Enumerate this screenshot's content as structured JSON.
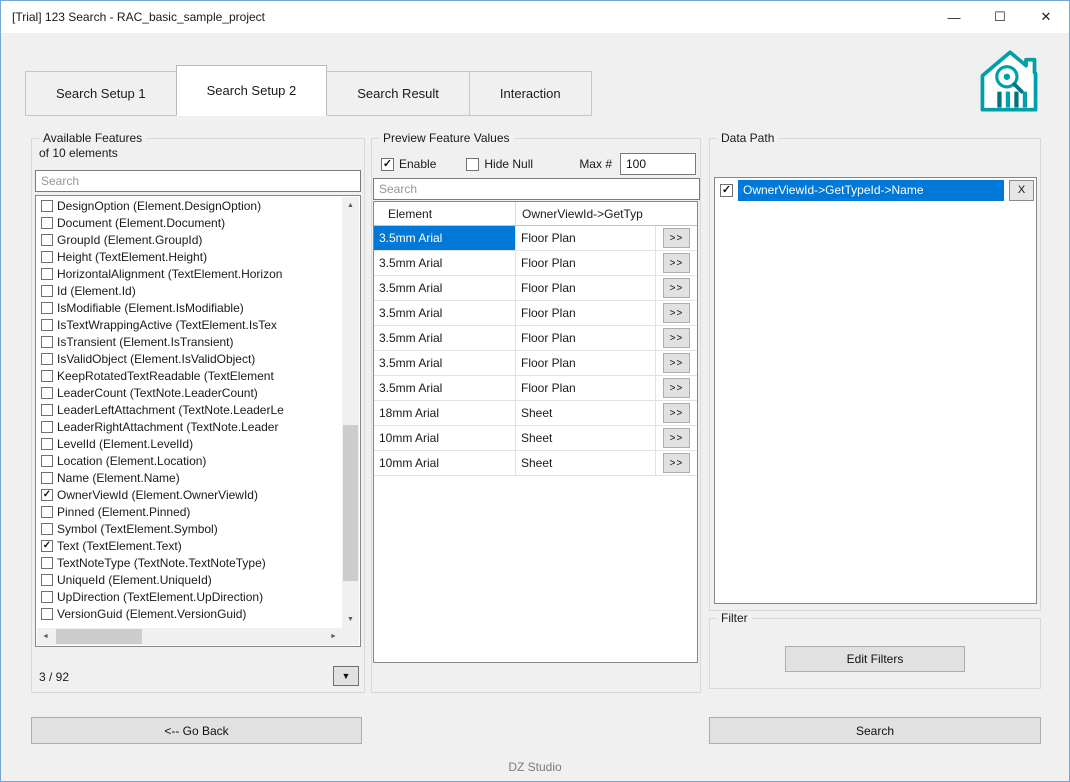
{
  "window": {
    "title": "[Trial] 123 Search - RAC_basic_sample_project",
    "controls": {
      "minimize": "—",
      "maximize": "☐",
      "close": "✕"
    },
    "footer": "DZ Studio"
  },
  "tabs": [
    {
      "label": "Search Setup 1",
      "active": false
    },
    {
      "label": "Search Setup 2",
      "active": true
    },
    {
      "label": "Search Result",
      "active": false
    },
    {
      "label": "Interaction",
      "active": false
    }
  ],
  "icons": {
    "scroll_up": "▲",
    "scroll_down": "▼",
    "scroll_left": "◄",
    "scroll_right": "►",
    "dropdown": "▼"
  },
  "features_panel": {
    "title": "Available Features",
    "subtitle": "of 10 elements",
    "search_placeholder": "Search",
    "status": "3 / 92",
    "items": [
      {
        "label": "DesignOption (Element.DesignOption)",
        "checked": false
      },
      {
        "label": "Document (Element.Document)",
        "checked": false
      },
      {
        "label": "GroupId (Element.GroupId)",
        "checked": false
      },
      {
        "label": "Height (TextElement.Height)",
        "checked": false
      },
      {
        "label": "HorizontalAlignment (TextElement.Horizon",
        "checked": false
      },
      {
        "label": "Id (Element.Id)",
        "checked": false
      },
      {
        "label": "IsModifiable (Element.IsModifiable)",
        "checked": false
      },
      {
        "label": "IsTextWrappingActive (TextElement.IsTex",
        "checked": false
      },
      {
        "label": "IsTransient (Element.IsTransient)",
        "checked": false
      },
      {
        "label": "IsValidObject (Element.IsValidObject)",
        "checked": false
      },
      {
        "label": "KeepRotatedTextReadable (TextElement",
        "checked": false
      },
      {
        "label": "LeaderCount (TextNote.LeaderCount)",
        "checked": false
      },
      {
        "label": "LeaderLeftAttachment (TextNote.LeaderLe",
        "checked": false
      },
      {
        "label": "LeaderRightAttachment (TextNote.Leader",
        "checked": false
      },
      {
        "label": "LevelId (Element.LevelId)",
        "checked": false
      },
      {
        "label": "Location (Element.Location)",
        "checked": false
      },
      {
        "label": "Name (Element.Name)",
        "checked": false
      },
      {
        "label": "OwnerViewId (Element.OwnerViewId)",
        "checked": true
      },
      {
        "label": "Pinned (Element.Pinned)",
        "checked": false
      },
      {
        "label": "Symbol (TextElement.Symbol)",
        "checked": false
      },
      {
        "label": "Text (TextElement.Text)",
        "checked": true
      },
      {
        "label": "TextNoteType (TextNote.TextNoteType)",
        "checked": false
      },
      {
        "label": "UniqueId (Element.UniqueId)",
        "checked": false
      },
      {
        "label": "UpDirection (TextElement.UpDirection)",
        "checked": false
      },
      {
        "label": "VersionGuid (Element.VersionGuid)",
        "checked": false
      }
    ]
  },
  "preview_panel": {
    "title": "Preview Feature Values",
    "enable": {
      "label": "Enable",
      "checked": true
    },
    "hide_null": {
      "label": "Hide Null",
      "checked": false
    },
    "max": {
      "label": "Max #",
      "value": "100"
    },
    "search_placeholder": "Search",
    "table": {
      "columns": [
        "Element",
        "OwnerViewId->GetTyp"
      ],
      "expand_label": ">>",
      "rows": [
        {
          "element": "3.5mm Arial",
          "value": "Floor Plan",
          "selected": true
        },
        {
          "element": "3.5mm Arial",
          "value": "Floor Plan",
          "selected": false
        },
        {
          "element": "3.5mm Arial",
          "value": "Floor Plan",
          "selected": false
        },
        {
          "element": "3.5mm Arial",
          "value": "Floor Plan",
          "selected": false
        },
        {
          "element": "3.5mm Arial",
          "value": "Floor Plan",
          "selected": false
        },
        {
          "element": "3.5mm Arial",
          "value": "Floor Plan",
          "selected": false
        },
        {
          "element": "3.5mm Arial",
          "value": "Floor Plan",
          "selected": false
        },
        {
          "element": "18mm Arial",
          "value": "Sheet",
          "selected": false
        },
        {
          "element": "10mm Arial",
          "value": "Sheet",
          "selected": false
        },
        {
          "element": "10mm Arial",
          "value": "Sheet",
          "selected": false
        }
      ]
    }
  },
  "data_path_panel": {
    "title": "Data Path",
    "items": [
      {
        "label": "OwnerViewId->GetTypeId->Name",
        "checked": true,
        "selected": true,
        "remove_label": "X"
      }
    ],
    "filter": {
      "title": "Filter",
      "edit_button": "Edit Filters"
    }
  },
  "actions": {
    "go_back": "<-- Go Back",
    "search": "Search"
  },
  "colors": {
    "selection": "#0078d7",
    "logo_teal": "#00a0a8",
    "logo_dark": "#00747c"
  }
}
